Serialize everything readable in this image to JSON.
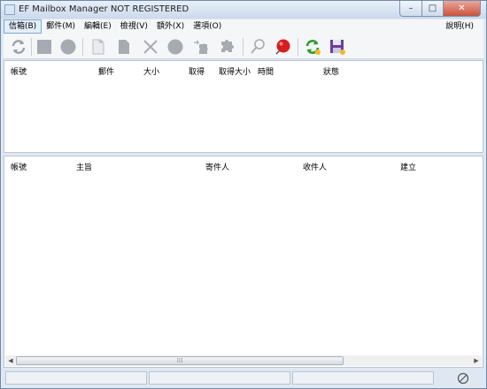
{
  "window": {
    "title": "EF Mailbox Manager NOT REGISTERED"
  },
  "menubar": {
    "items": [
      {
        "label": "信箱(B)"
      },
      {
        "label": "郵件(M)"
      },
      {
        "label": "編輯(E)"
      },
      {
        "label": "檢視(V)"
      },
      {
        "label": "額外(X)"
      },
      {
        "label": "選項(O)"
      }
    ],
    "help": "說明(H)"
  },
  "toolbar": {
    "icons": [
      "refresh-icon",
      "stop-square-icon",
      "record-circle-icon",
      "new-document-icon",
      "document-icon",
      "delete-x-icon",
      "circle-icon",
      "forward-puzzle-icon",
      "puzzle-icon",
      "pushpin-icon",
      "red-ball-icon",
      "green-refresh-icon",
      "save-disk-icon"
    ],
    "colors": {
      "disabled": "#a9aeb5",
      "accent_red": "#d81e1e",
      "accent_green": "#2e9a2e",
      "accent_purple": "#6a3fa0",
      "accent_gold": "#f2b824"
    }
  },
  "accounts_table": {
    "columns": [
      "帳號",
      "郵件",
      "大小",
      "取得",
      "取得大小",
      "時間",
      "狀態"
    ]
  },
  "messages_table": {
    "columns": [
      "帳號",
      "主旨",
      "寄件人",
      "收件人",
      "建立"
    ]
  },
  "scrollbar": {
    "grip": "⁞⁞⁞"
  }
}
